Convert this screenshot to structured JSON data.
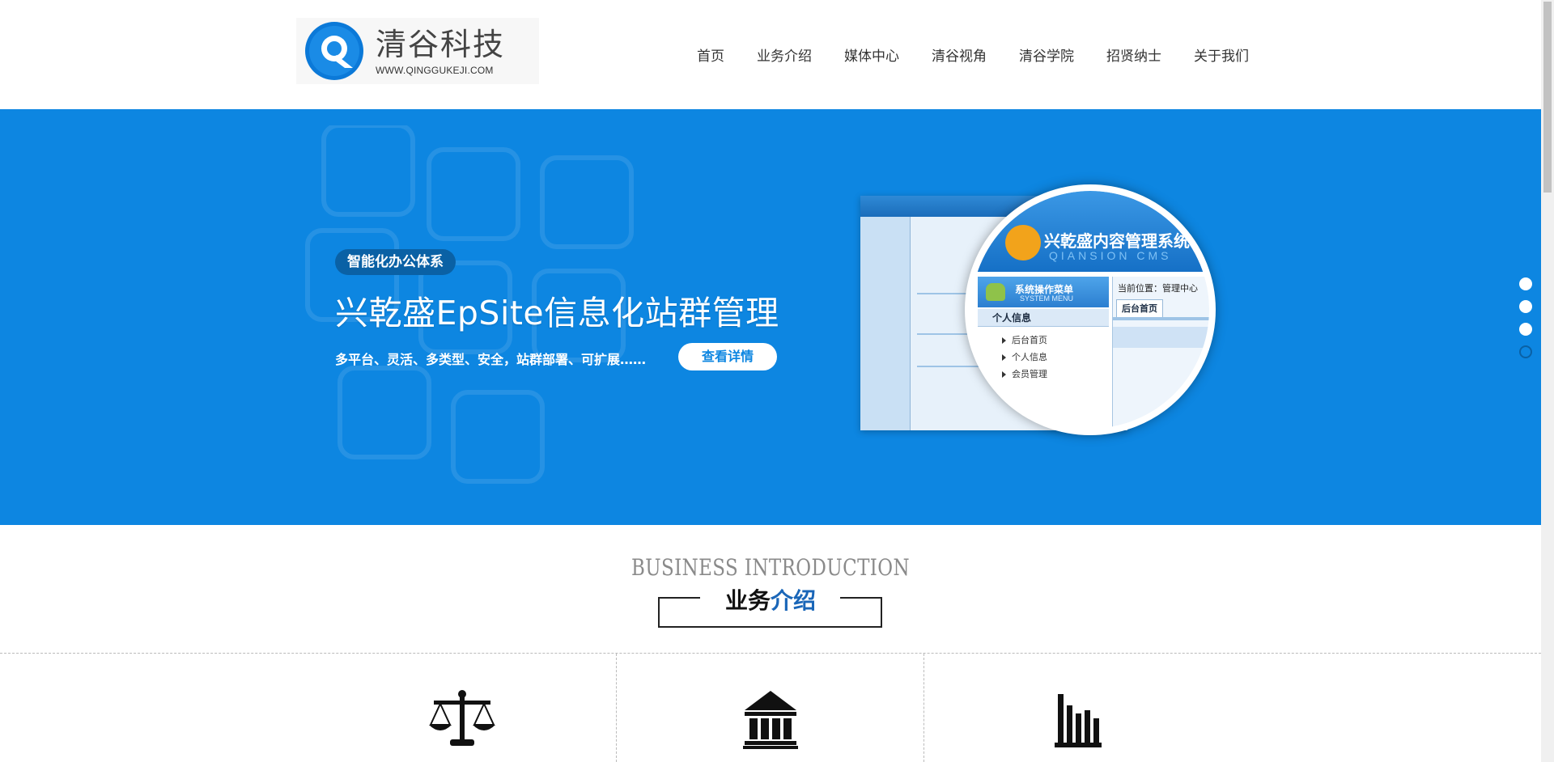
{
  "header": {
    "logo_name": "清谷科技",
    "logo_url": "WWW.QINGGUKEJI.COM",
    "nav": [
      "首页",
      "业务介绍",
      "媒体中心",
      "清谷视角",
      "清谷学院",
      "招贤纳士",
      "关于我们"
    ]
  },
  "banner": {
    "tag": "智能化办公体系",
    "headline": "兴乾盛EpSite信息化站群管理",
    "subline": "多平台、灵活、多类型、安全，站群部署、可扩展……",
    "button": "查看详情",
    "screenshot": {
      "title": "兴乾盛内容管理系统",
      "subtitle": "QIANSION CMS",
      "menu_title": "系统操作菜单",
      "menu_sub": "SYSTEM MENU",
      "section": "个人信息",
      "items": [
        "后台首页",
        "个人信息",
        "会员管理"
      ],
      "crumb": "当前位置：管理中心",
      "tab": "后台首页"
    },
    "slide_count": 4,
    "active_slide": 4
  },
  "business": {
    "title_en": "BUSINESS INTRODUCTION",
    "title_cn_a": "业务",
    "title_cn_b": "介绍",
    "icons": [
      "scales-icon",
      "bank-icon",
      "bar-chart-icon"
    ]
  },
  "colors": {
    "banner": "#0d86e1",
    "accent": "#1a66b8"
  }
}
